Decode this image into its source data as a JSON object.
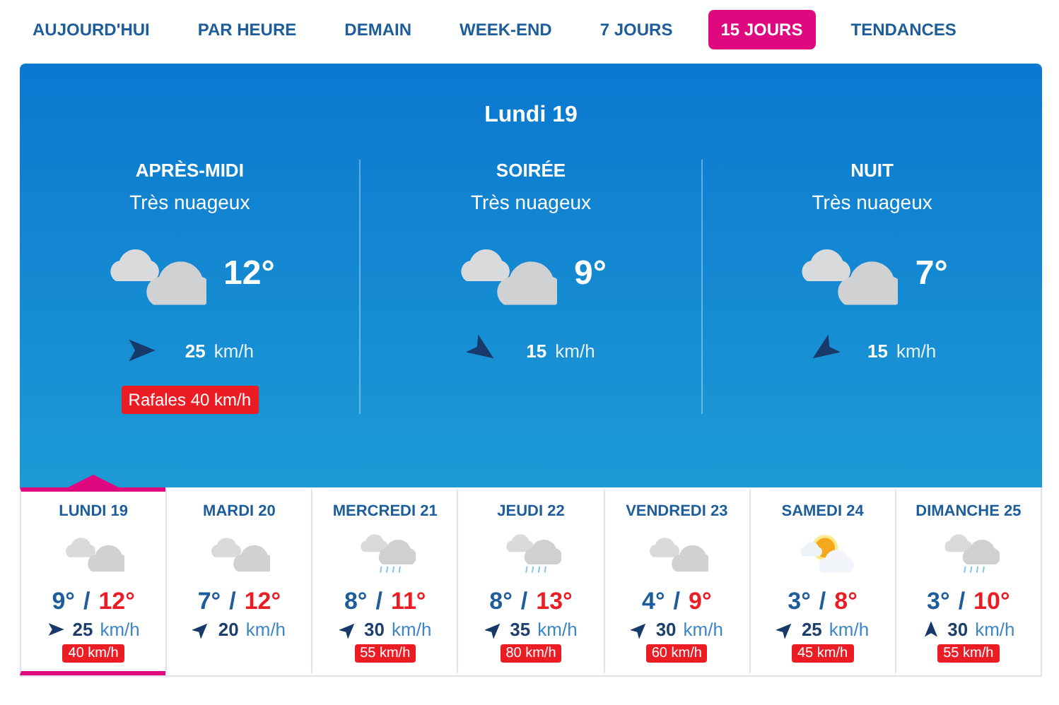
{
  "tabs": [
    {
      "label": "AUJOURD'HUI",
      "selected": false
    },
    {
      "label": "PAR HEURE",
      "selected": false
    },
    {
      "label": "DEMAIN",
      "selected": false
    },
    {
      "label": "WEEK-END",
      "selected": false
    },
    {
      "label": "7 JOURS",
      "selected": false
    },
    {
      "label": "15 JOURS",
      "selected": true
    },
    {
      "label": "TENDANCES",
      "selected": false
    }
  ],
  "detail": {
    "title": "Lundi 19",
    "periods": [
      {
        "name": "APRÈS-MIDI",
        "condition": "Très nuageux",
        "kind": "cloudy",
        "temp": "12°",
        "wind": {
          "kind": "east",
          "speed": "25",
          "unit": "km/h"
        },
        "gust": "Rafales 40 km/h"
      },
      {
        "name": "SOIRÉE",
        "condition": "Très nuageux",
        "kind": "cloudy",
        "temp": "9°",
        "wind": {
          "kind": "southeast",
          "speed": "15",
          "unit": "km/h"
        }
      },
      {
        "name": "NUIT",
        "condition": "Très nuageux",
        "kind": "cloudy",
        "temp": "7°",
        "wind": {
          "kind": "southwest",
          "speed": "15",
          "unit": "km/h"
        }
      }
    ]
  },
  "days": [
    {
      "label": "LUNDI 19",
      "selected": true,
      "kind": "cloudy",
      "low": "9°",
      "separator": "/",
      "high": "12°",
      "wind": {
        "kind": "east",
        "speed": "25",
        "unit": "km/h"
      },
      "gust": "40 km/h"
    },
    {
      "label": "MARDI 20",
      "selected": false,
      "kind": "cloudy",
      "low": "7°",
      "separator": "/",
      "high": "12°",
      "wind": {
        "kind": "northeast",
        "speed": "20",
        "unit": "km/h"
      }
    },
    {
      "label": "MERCREDI 21",
      "selected": false,
      "kind": "rain",
      "low": "8°",
      "separator": "/",
      "high": "11°",
      "wind": {
        "kind": "northeast",
        "speed": "30",
        "unit": "km/h"
      },
      "gust": "55 km/h"
    },
    {
      "label": "JEUDI 22",
      "selected": false,
      "kind": "rain",
      "low": "8°",
      "separator": "/",
      "high": "13°",
      "wind": {
        "kind": "northeast",
        "speed": "35",
        "unit": "km/h"
      },
      "gust": "80 km/h"
    },
    {
      "label": "VENDREDI 23",
      "selected": false,
      "kind": "cloudy",
      "low": "4°",
      "separator": "/",
      "high": "9°",
      "wind": {
        "kind": "northeast",
        "speed": "30",
        "unit": "km/h"
      },
      "gust": "60 km/h"
    },
    {
      "label": "SAMEDI 24",
      "selected": false,
      "kind": "suncloud",
      "low": "3°",
      "separator": "/",
      "high": "8°",
      "wind": {
        "kind": "northeast",
        "speed": "25",
        "unit": "km/h"
      },
      "gust": "45 km/h"
    },
    {
      "label": "DIMANCHE 25",
      "selected": false,
      "kind": "rain",
      "low": "3°",
      "separator": "/",
      "high": "10°",
      "wind": {
        "kind": "north",
        "speed": "30",
        "unit": "km/h"
      },
      "gust": "55 km/h"
    }
  ]
}
